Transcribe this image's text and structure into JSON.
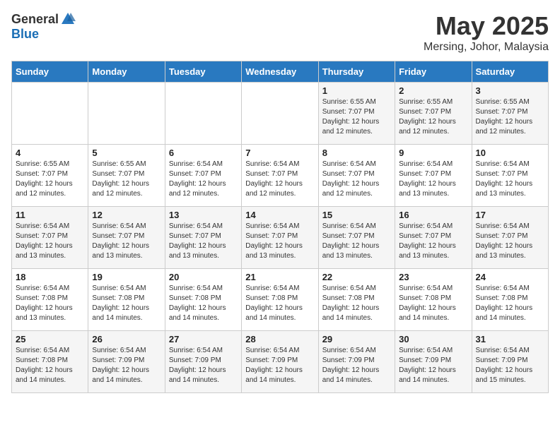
{
  "header": {
    "logo_general": "General",
    "logo_blue": "Blue",
    "title": "May 2025",
    "subtitle": "Mersing, Johor, Malaysia"
  },
  "calendar": {
    "days_of_week": [
      "Sunday",
      "Monday",
      "Tuesday",
      "Wednesday",
      "Thursday",
      "Friday",
      "Saturday"
    ],
    "weeks": [
      [
        {
          "day": "",
          "info": ""
        },
        {
          "day": "",
          "info": ""
        },
        {
          "day": "",
          "info": ""
        },
        {
          "day": "",
          "info": ""
        },
        {
          "day": "1",
          "info": "Sunrise: 6:55 AM\nSunset: 7:07 PM\nDaylight: 12 hours\nand 12 minutes."
        },
        {
          "day": "2",
          "info": "Sunrise: 6:55 AM\nSunset: 7:07 PM\nDaylight: 12 hours\nand 12 minutes."
        },
        {
          "day": "3",
          "info": "Sunrise: 6:55 AM\nSunset: 7:07 PM\nDaylight: 12 hours\nand 12 minutes."
        }
      ],
      [
        {
          "day": "4",
          "info": "Sunrise: 6:55 AM\nSunset: 7:07 PM\nDaylight: 12 hours\nand 12 minutes."
        },
        {
          "day": "5",
          "info": "Sunrise: 6:55 AM\nSunset: 7:07 PM\nDaylight: 12 hours\nand 12 minutes."
        },
        {
          "day": "6",
          "info": "Sunrise: 6:54 AM\nSunset: 7:07 PM\nDaylight: 12 hours\nand 12 minutes."
        },
        {
          "day": "7",
          "info": "Sunrise: 6:54 AM\nSunset: 7:07 PM\nDaylight: 12 hours\nand 12 minutes."
        },
        {
          "day": "8",
          "info": "Sunrise: 6:54 AM\nSunset: 7:07 PM\nDaylight: 12 hours\nand 12 minutes."
        },
        {
          "day": "9",
          "info": "Sunrise: 6:54 AM\nSunset: 7:07 PM\nDaylight: 12 hours\nand 13 minutes."
        },
        {
          "day": "10",
          "info": "Sunrise: 6:54 AM\nSunset: 7:07 PM\nDaylight: 12 hours\nand 13 minutes."
        }
      ],
      [
        {
          "day": "11",
          "info": "Sunrise: 6:54 AM\nSunset: 7:07 PM\nDaylight: 12 hours\nand 13 minutes."
        },
        {
          "day": "12",
          "info": "Sunrise: 6:54 AM\nSunset: 7:07 PM\nDaylight: 12 hours\nand 13 minutes."
        },
        {
          "day": "13",
          "info": "Sunrise: 6:54 AM\nSunset: 7:07 PM\nDaylight: 12 hours\nand 13 minutes."
        },
        {
          "day": "14",
          "info": "Sunrise: 6:54 AM\nSunset: 7:07 PM\nDaylight: 12 hours\nand 13 minutes."
        },
        {
          "day": "15",
          "info": "Sunrise: 6:54 AM\nSunset: 7:07 PM\nDaylight: 12 hours\nand 13 minutes."
        },
        {
          "day": "16",
          "info": "Sunrise: 6:54 AM\nSunset: 7:07 PM\nDaylight: 12 hours\nand 13 minutes."
        },
        {
          "day": "17",
          "info": "Sunrise: 6:54 AM\nSunset: 7:07 PM\nDaylight: 12 hours\nand 13 minutes."
        }
      ],
      [
        {
          "day": "18",
          "info": "Sunrise: 6:54 AM\nSunset: 7:08 PM\nDaylight: 12 hours\nand 13 minutes."
        },
        {
          "day": "19",
          "info": "Sunrise: 6:54 AM\nSunset: 7:08 PM\nDaylight: 12 hours\nand 14 minutes."
        },
        {
          "day": "20",
          "info": "Sunrise: 6:54 AM\nSunset: 7:08 PM\nDaylight: 12 hours\nand 14 minutes."
        },
        {
          "day": "21",
          "info": "Sunrise: 6:54 AM\nSunset: 7:08 PM\nDaylight: 12 hours\nand 14 minutes."
        },
        {
          "day": "22",
          "info": "Sunrise: 6:54 AM\nSunset: 7:08 PM\nDaylight: 12 hours\nand 14 minutes."
        },
        {
          "day": "23",
          "info": "Sunrise: 6:54 AM\nSunset: 7:08 PM\nDaylight: 12 hours\nand 14 minutes."
        },
        {
          "day": "24",
          "info": "Sunrise: 6:54 AM\nSunset: 7:08 PM\nDaylight: 12 hours\nand 14 minutes."
        }
      ],
      [
        {
          "day": "25",
          "info": "Sunrise: 6:54 AM\nSunset: 7:08 PM\nDaylight: 12 hours\nand 14 minutes."
        },
        {
          "day": "26",
          "info": "Sunrise: 6:54 AM\nSunset: 7:09 PM\nDaylight: 12 hours\nand 14 minutes."
        },
        {
          "day": "27",
          "info": "Sunrise: 6:54 AM\nSunset: 7:09 PM\nDaylight: 12 hours\nand 14 minutes."
        },
        {
          "day": "28",
          "info": "Sunrise: 6:54 AM\nSunset: 7:09 PM\nDaylight: 12 hours\nand 14 minutes."
        },
        {
          "day": "29",
          "info": "Sunrise: 6:54 AM\nSunset: 7:09 PM\nDaylight: 12 hours\nand 14 minutes."
        },
        {
          "day": "30",
          "info": "Sunrise: 6:54 AM\nSunset: 7:09 PM\nDaylight: 12 hours\nand 14 minutes."
        },
        {
          "day": "31",
          "info": "Sunrise: 6:54 AM\nSunset: 7:09 PM\nDaylight: 12 hours\nand 15 minutes."
        }
      ]
    ]
  }
}
